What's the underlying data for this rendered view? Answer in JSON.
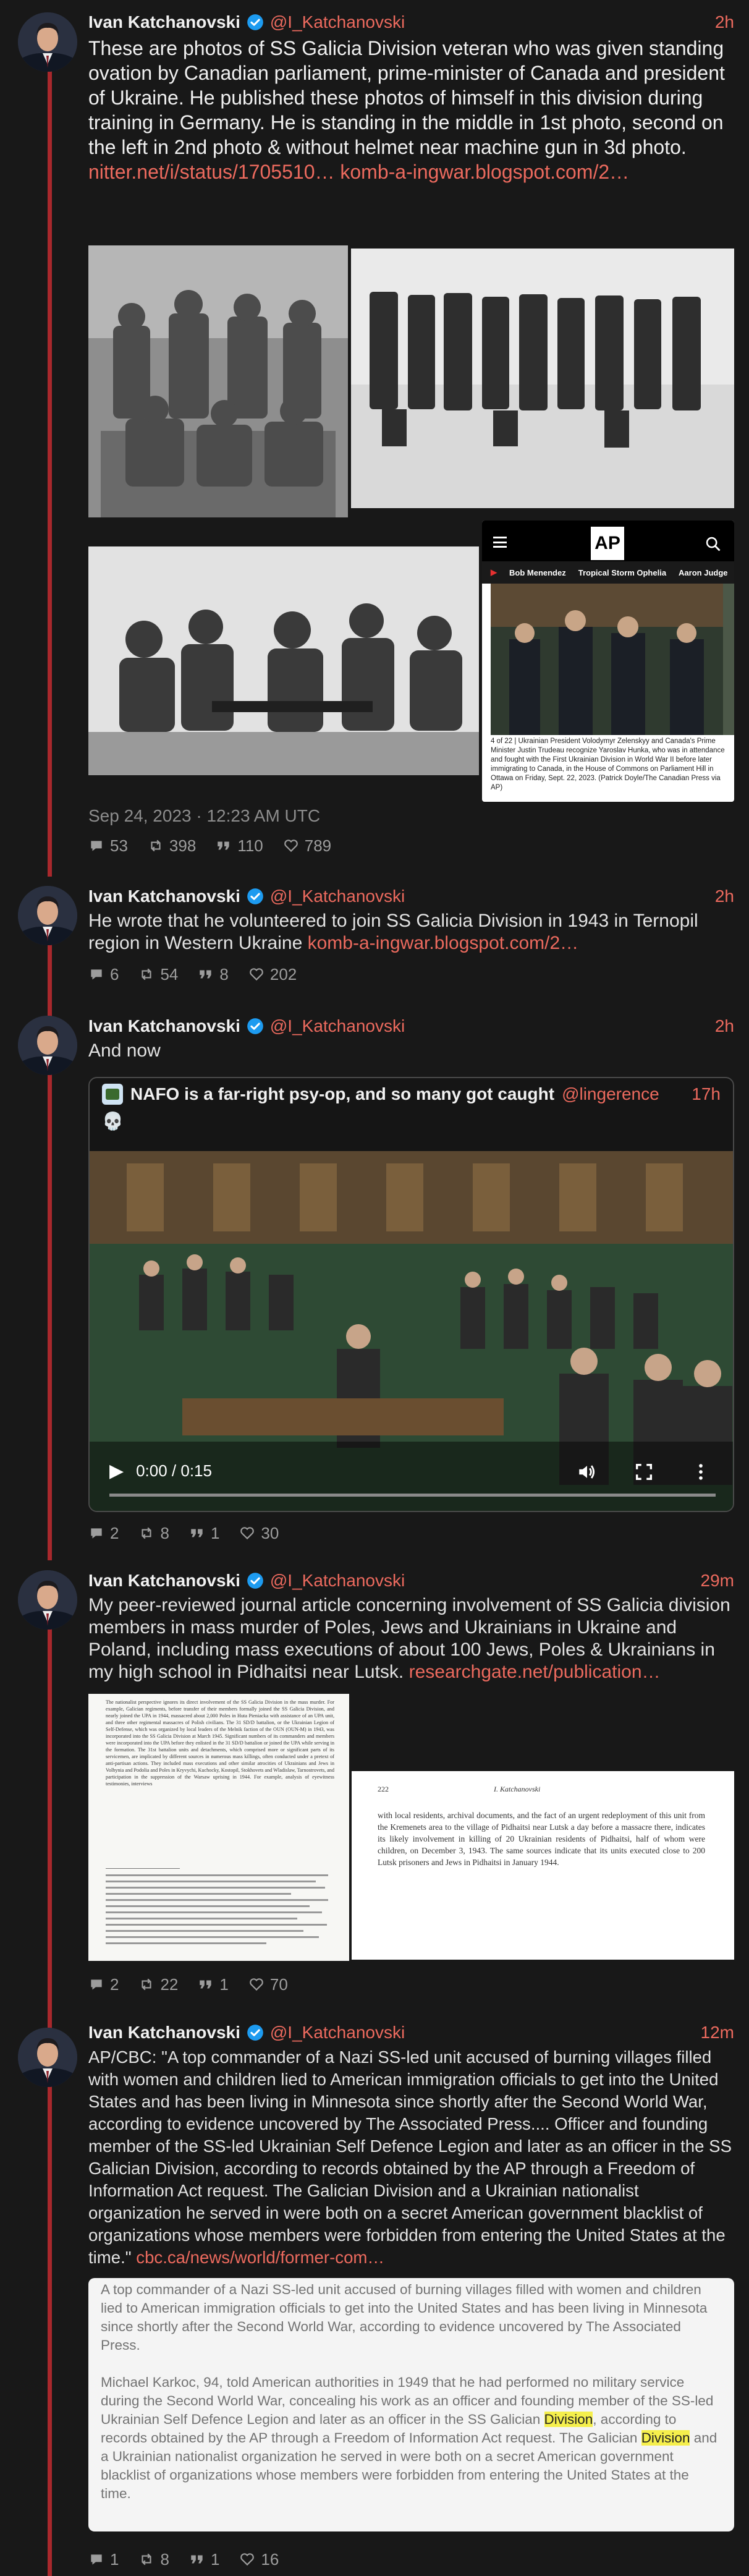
{
  "colors": {
    "background": "#181818",
    "accent": "#ec6a5e",
    "thread_line": "#a8282c",
    "verified": "#1d9bf0"
  },
  "tweets": [
    {
      "name": "Ivan Katchanovski",
      "handle": "@I_Katchanovski",
      "time": "2h",
      "text": "These are photos of SS Galicia Division veteran who was given standing ovation by Canadian parliament, prime-minister of Canada and president of Ukraine. He published these photos of himself in this division during training in Germany. He is standing in the middle in 1st photo, second on the left in 2nd photo & without helmet near machine gun in 3d photo.",
      "links": "nitter.net/i/status/1705510… komb-a-ingwar.blogspot.com/2…",
      "date": "Sep 24, 2023 · 12:23 AM UTC",
      "stats": {
        "comments": "53",
        "retweets": "398",
        "quotes": "110",
        "likes": "789"
      }
    },
    {
      "name": "Ivan Katchanovski",
      "handle": "@I_Katchanovski",
      "time": "2h",
      "text": "He wrote that he volunteered to join SS Galicia Division in 1943 in Ternopil region in Western Ukraine ",
      "link": "komb-a-ingwar.blogspot.com/2…",
      "stats": {
        "comments": "6",
        "retweets": "54",
        "quotes": "8",
        "likes": "202"
      }
    },
    {
      "name": "Ivan Katchanovski",
      "handle": "@I_Katchanovski",
      "time": "2h",
      "text": "And now",
      "stats": {
        "comments": "2",
        "retweets": "8",
        "quotes": "1",
        "likes": "30"
      }
    },
    {
      "name": "Ivan Katchanovski",
      "handle": "@I_Katchanovski",
      "time": "29m",
      "text": "My peer-reviewed journal article concerning involvement of SS Galicia division members in mass murder of Poles, Jews and Ukrainians in Ukraine and Poland, including mass executions of about 100 Jews, Poles & Ukrainians in my high school in Pidhaitsi near Lutsk. ",
      "link": "researchgate.net/publication…",
      "stats": {
        "comments": "2",
        "retweets": "22",
        "quotes": "1",
        "likes": "70"
      }
    },
    {
      "name": "Ivan Katchanovski",
      "handle": "@I_Katchanovski",
      "time": "12m",
      "text": "AP/CBC: \"A top commander of a Nazi SS-led unit accused of burning villages filled with women and children lied to American immigration officials to get into the United States and has been living in Minnesota since shortly after the Second World War, according to evidence uncovered by The Associated Press.... Officer and founding member of the SS-led Ukrainian Self Defence Legion and later as an officer in the SS Galician Division, according to records obtained by the AP through a Freedom of Information Act request. The Galician Division and a Ukrainian nationalist organization he served in were both on a secret American government blacklist of organizations whose members were forbidden from entering the United States at the time.\" ",
      "link": "cbc.ca/news/world/former-com…",
      "stats": {
        "comments": "1",
        "retweets": "8",
        "quotes": "1",
        "likes": "16"
      }
    }
  ],
  "ap_screenshot": {
    "logo": "AP",
    "nav": [
      "Bob Menendez",
      "Tropical Storm Ophelia",
      "Aaron Judge"
    ],
    "caption": "4 of 22 | Ukrainian President Volodymyr Zelenskyy and Canada's Prime Minister Justin Trudeau recognize Yaroslav Hunka, who was in attendance and fought with the First Ukrainian Division in World War II before later immigrating to Canada, in the House of Commons on Parliament Hill in Ottawa on Friday, Sept. 22, 2023. (Patrick Doyle/The Canadian Press via AP)"
  },
  "quote": {
    "name": "NAFO is a far-right psy-op, and so many got caught",
    "handle": "@lingerence",
    "time": "17h",
    "emoji": "💀",
    "video_time": "0:00 / 0:15"
  },
  "article": {
    "page_number": "222",
    "running_head": "I. Katchanovski",
    "left_text": "The nationalist perspective ignores its direct involvement of the SS Galicia Division in the mass murder. For example, Galician regiments, before transfer of their members formally joined the SS Galicia Division, and nearly joined the UPA in 1944, massacred about 2,000 Poles in Huta Pieniacka with assistance of an UPA unit, and three other regimental massacres of Polish civilians. The 31 SD/D battalion, or the Ukrainian Legion of Self-Defense, which was organized by local leaders of the Melnik faction of the OUN (OUN-M) in 1943, was incorporated into the SS Galicia Division at March 1945. Significant numbers of its commanders and members were incorporated into the UPA before they enlisted in the 31 SD/D battalion or joined the UPA while serving in the formation. The 31st battalion units and detachments, which comprised more or significant parts of its servicemen, are implicated by different sources in numerous mass killings, often conducted under a pretext of anti-partisan actions. They included mass executions and other similar atrocities of Ukrainians and Jews in Volhynia and Podolia and Poles in Kryvychi, Kuchocky, Kostopil, Stokhovets and Wladislaw, Tarnostrovets, and participation in the suppression of the Warsaw uprising in 1944. For example, analysis of eyewitness testimonies, interviews",
    "right_text": "with local residents, archival documents, and the fact of an urgent redeployment of this unit from the Kremenets area to the village of Pidhaitsi near Lutsk a day before a massacre there, indicates its likely involvement in killing of 20 Ukrainian residents of Pidhaitsi, half of whom were children, on December 3, 1943. The same sources indicate that its units executed close to 200 Lutsk prisoners and Jews in Pidhaitsi in January 1944."
  },
  "excerpt": {
    "p1": "A top commander of a Nazi SS-led unit accused of burning villages filled with women and children lied to American immigration officials to get into the United States and has been living in Minnesota since shortly after the Second World War, according to evidence uncovered by The Associated Press.",
    "p2a": "Michael Karkoc, 94, told American authorities in 1949 that he had performed no military service during the Second World War, concealing his work as an officer and founding member of the SS-led Ukrainian Self Defence Legion and later as an officer in the SS Galician ",
    "hl1": "Division",
    "p2b": ", according to records obtained by the AP through a Freedom of Information Act request. The Galician ",
    "hl2": "Division",
    "p2c": " and a Ukrainian nationalist organization he served in were both on a secret American government blacklist of organizations whose members were forbidden from entering the United States at the time."
  }
}
